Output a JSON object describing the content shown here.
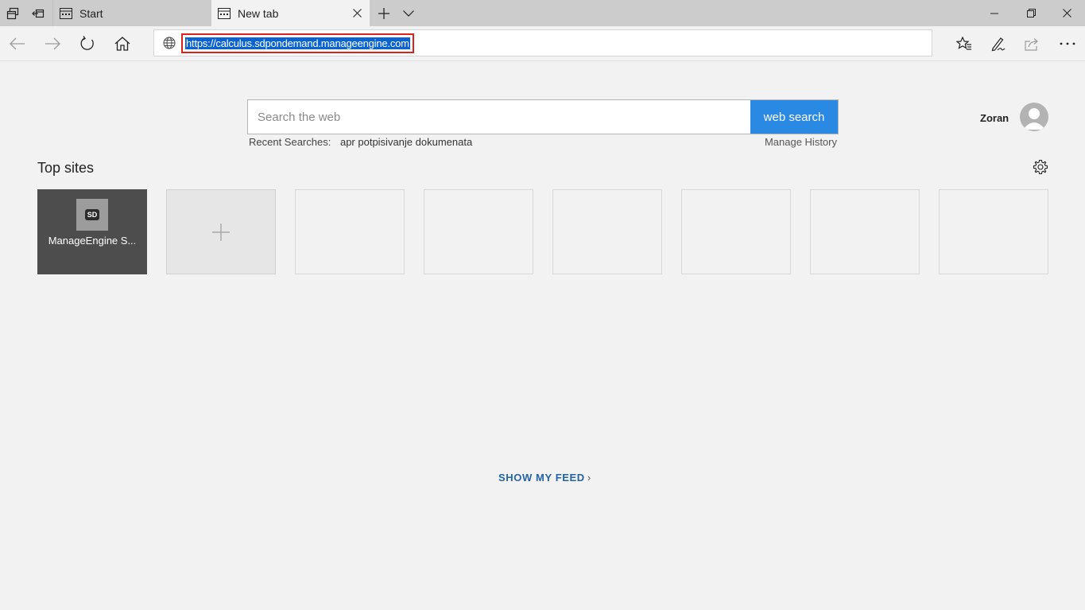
{
  "titlebar": {
    "tabs": [
      {
        "label": "Start",
        "active": false
      },
      {
        "label": "New tab",
        "active": true
      }
    ]
  },
  "navbar": {
    "url": "https://calculus.sdpondemand.manageengine.com"
  },
  "search": {
    "placeholder": "Search the web",
    "button_label": "web search",
    "recent_label": "Recent Searches:",
    "recent_items": [
      "apr potpisivanje dokumenata"
    ],
    "manage_history": "Manage History"
  },
  "profile": {
    "name": "Zoran"
  },
  "topsites": {
    "title": "Top sites",
    "sites": [
      {
        "label": "ManageEngine S...",
        "icon_text": "SD"
      }
    ]
  },
  "feed": {
    "label": "SHOW MY FEED",
    "chevron": "›"
  },
  "colors": {
    "accent": "#2a8ae3",
    "url_highlight": "#0a63cf",
    "annotation_box": "#e0201b",
    "feed_link": "#2464a6"
  }
}
